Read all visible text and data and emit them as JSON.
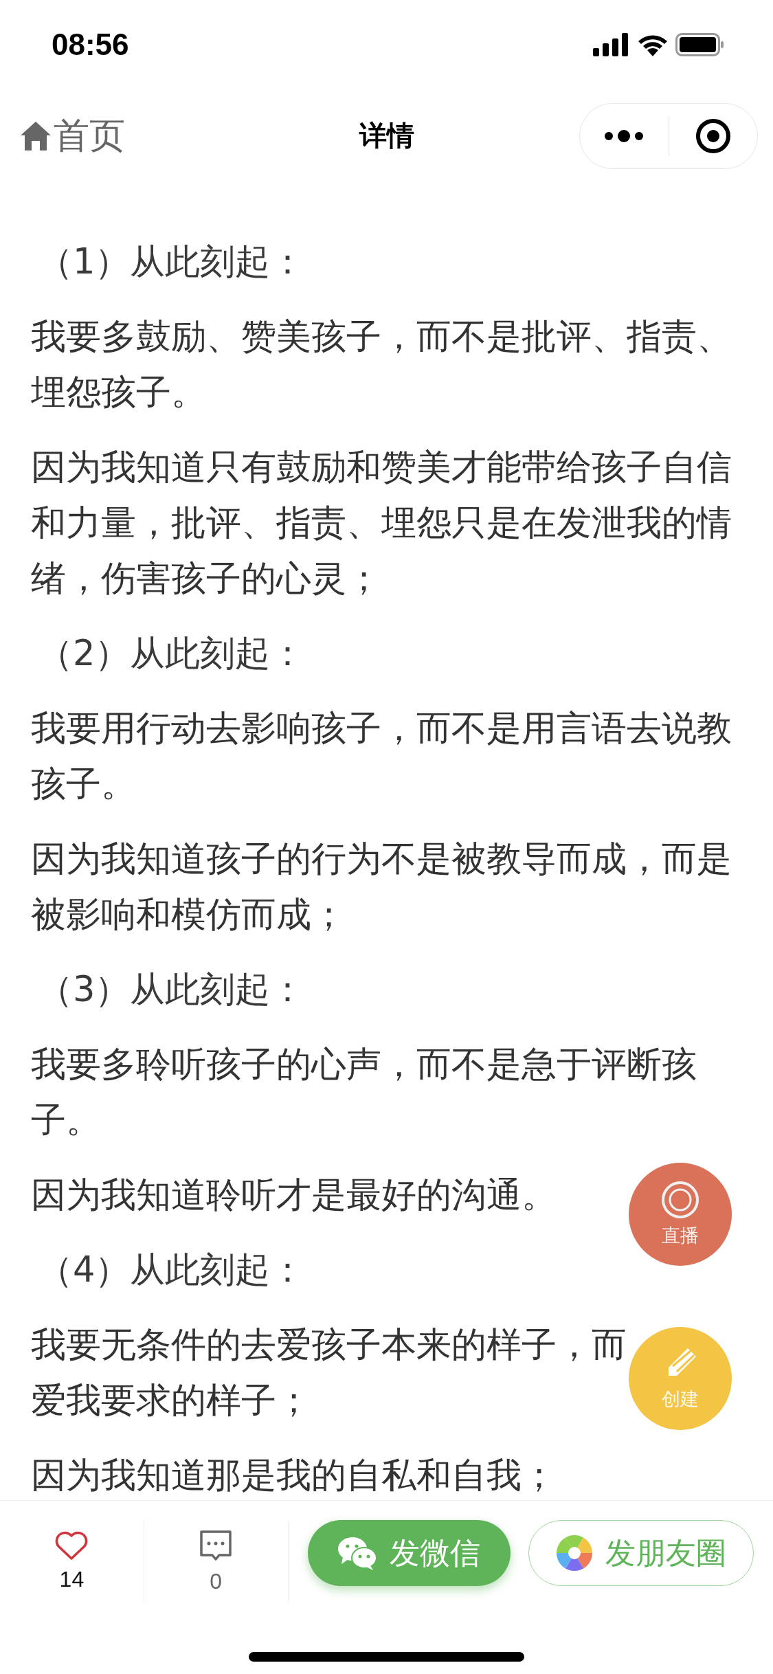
{
  "status_bar": {
    "time": "08:56"
  },
  "nav": {
    "back_label": "首页",
    "title": "详情"
  },
  "paragraphs": [
    {
      "kind": "heading",
      "text": "（1）从此刻起："
    },
    {
      "kind": "body",
      "text": "我要多鼓励、赞美孩子，而不是批评、指责、埋怨孩子。"
    },
    {
      "kind": "body",
      "text": "因为我知道只有鼓励和赞美才能带给孩子自信和力量，批评、指责、埋怨只是在发泄我的情绪，伤害孩子的心灵；"
    },
    {
      "kind": "heading",
      "text": "（2）从此刻起："
    },
    {
      "kind": "body",
      "text": "我要用行动去影响孩子，而不是用言语去说教孩子。"
    },
    {
      "kind": "body",
      "text": "因为我知道孩子的行为不是被教导而成，而是被影响和模仿而成；"
    },
    {
      "kind": "heading",
      "text": "（3）从此刻起："
    },
    {
      "kind": "body",
      "text": "我要多聆听孩子的心声，而不是急于评断孩子。"
    },
    {
      "kind": "body",
      "text": "因为我知道聆听才是最好的沟通。"
    },
    {
      "kind": "heading",
      "text": "（4）从此刻起："
    },
    {
      "kind": "body",
      "lines": [
        "我要无条件的去爱孩子本来的样子，而",
        "爱我要求的样子；"
      ]
    },
    {
      "kind": "body",
      "text": "因为我知道那是我的自私和自我；"
    }
  ],
  "floating_buttons": [
    {
      "kind": "live",
      "label": "直播",
      "color": "#da725a"
    },
    {
      "kind": "create",
      "label": "创建",
      "color": "#f4c444"
    }
  ],
  "bottom_bar": {
    "likes": "14",
    "comments": "0",
    "actions": [
      {
        "kind": "wechat",
        "label": "发微信"
      },
      {
        "kind": "moments",
        "label": "发朋友圈"
      }
    ]
  }
}
